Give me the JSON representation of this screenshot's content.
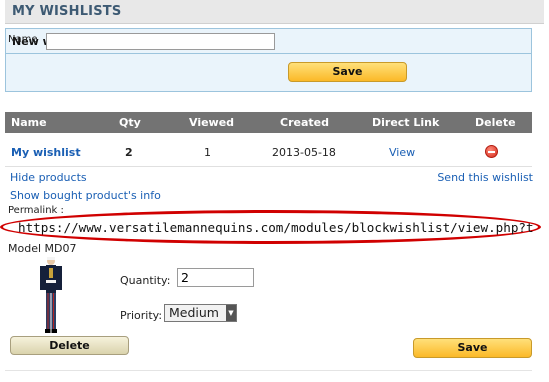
{
  "header": {
    "title": "MY WISHLISTS"
  },
  "new_wishlist": {
    "heading": "New wishlist",
    "name_label": "Name",
    "name_value": "",
    "save_label": "Save"
  },
  "table": {
    "headers": [
      "Name",
      "Qty",
      "Viewed",
      "Created",
      "Direct Link",
      "Delete"
    ],
    "row": {
      "name": "My wishlist",
      "qty": "2",
      "viewed": "1",
      "created": "2013-05-18",
      "direct_link": "View"
    }
  },
  "links": {
    "hide_products": "Hide products",
    "send_wishlist": "Send this wishlist",
    "show_bought": "Show bought product's info"
  },
  "permalink": {
    "label": "Permalink :",
    "url": "https://www.versatilemannequins.com/modules/blockwishlist/view.php?tok"
  },
  "product": {
    "model": "Model MD07",
    "quantity_label": "Quantity:",
    "quantity_value": "2",
    "priority_label": "Priority:",
    "priority_value": "Medium",
    "delete_label": "Delete",
    "save_label": "Save"
  },
  "colors": {
    "accent_yellow": "#fbb928",
    "header_gray": "#737373",
    "link_blue": "#1a5fb4",
    "highlight_red": "#d00000"
  },
  "icons": [
    "delete-icon",
    "select-arrow-icon"
  ]
}
